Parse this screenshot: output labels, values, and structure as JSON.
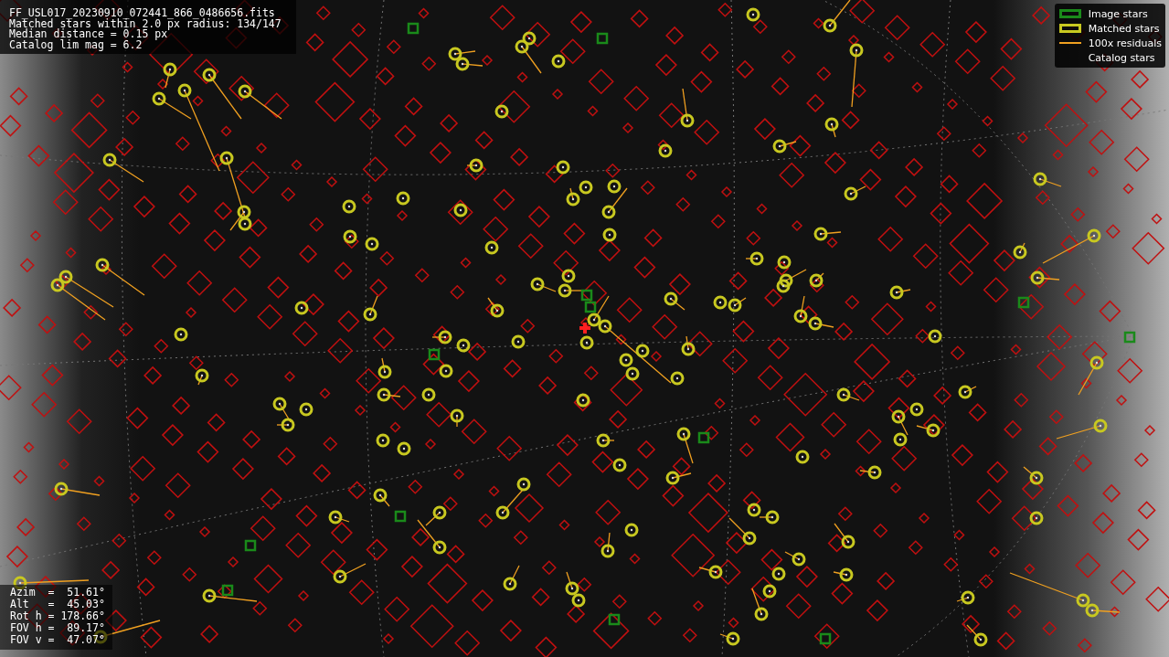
{
  "info_box": {
    "lines": [
      "FF_USL017_20230910_072441_866_0486656.fits",
      "Matched stars within 2.0 px radius: 134/147",
      "Median distance = 0.15 px",
      "Catalog lim mag = 6.2"
    ]
  },
  "legend": {
    "items": [
      {
        "label": "Image stars",
        "kind": "box",
        "color": "#1a8a1a"
      },
      {
        "label": "Matched stars",
        "kind": "box",
        "color": "#c8c820"
      },
      {
        "label": "100x residuals",
        "kind": "line",
        "color": "#f0a020"
      },
      {
        "label": "Catalog stars",
        "kind": "blank"
      }
    ]
  },
  "pointing": {
    "lines": [
      "Azim  =  51.61°",
      "Alt   =  45.03°",
      "Rot h = 178.66°",
      "FOV h =  89.17°",
      "FOV v =  47.07°"
    ]
  }
}
